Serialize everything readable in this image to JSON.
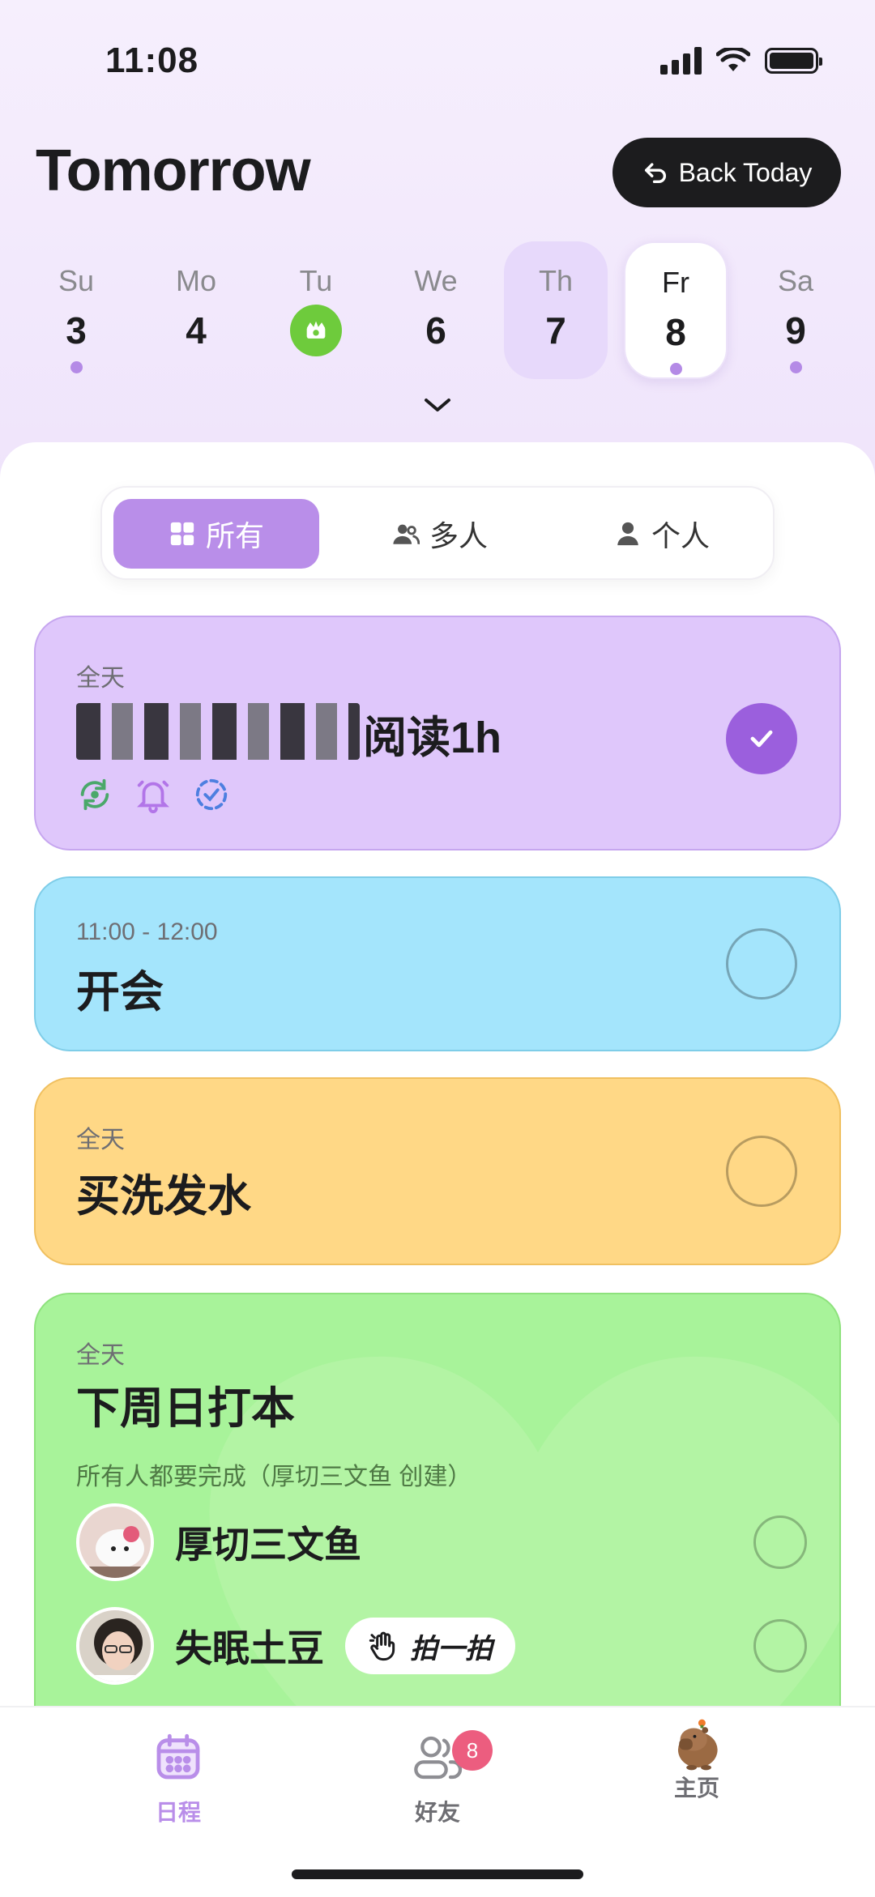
{
  "status_bar": {
    "time": "11:08"
  },
  "header": {
    "title": "Tomorrow",
    "back_today_label": "Back Today"
  },
  "week": [
    {
      "name": "Su",
      "num": "3",
      "has_dot": true
    },
    {
      "name": "Mo",
      "num": "4",
      "has_dot": false
    },
    {
      "name": "Tu",
      "num": "",
      "is_today_badge": true
    },
    {
      "name": "We",
      "num": "6",
      "has_dot": false
    },
    {
      "name": "Th",
      "num": "7",
      "has_dot": false,
      "highlight": true
    },
    {
      "name": "Fr",
      "num": "8",
      "has_dot": true,
      "selected": true
    },
    {
      "name": "Sa",
      "num": "9",
      "has_dot": true
    }
  ],
  "filters": [
    {
      "label": "所有",
      "icon": "grid-icon",
      "active": true
    },
    {
      "label": "多人",
      "icon": "people-icon",
      "active": false
    },
    {
      "label": "个人",
      "icon": "person-icon",
      "active": false
    }
  ],
  "tasks": [
    {
      "time": "全天",
      "title": "阅读1h",
      "done": true,
      "color": "#dfc7fb",
      "icons": [
        "repeat-icon",
        "bell-icon",
        "check-dashed-icon"
      ]
    },
    {
      "time": "11:00 - 12:00",
      "title": "开会",
      "done": false,
      "color": "#a4e5fc"
    },
    {
      "time": "全天",
      "title": "买洗发水",
      "done": false,
      "color": "#ffd886"
    },
    {
      "time": "全天",
      "title": "下周日打本",
      "note": "所有人都要完成（厚切三文鱼 创建）",
      "done": false,
      "color": "#a8f39a",
      "members": [
        {
          "name": "厚切三文鱼"
        },
        {
          "name": "失眠土豆",
          "action": "拍一拍"
        }
      ]
    }
  ],
  "tab_bar": {
    "tabs": [
      {
        "label": "日程",
        "icon": "calendar-icon",
        "active": true
      },
      {
        "label": "好友",
        "icon": "friends-icon",
        "badge": "8"
      },
      {
        "label": "主页",
        "icon": "capybara-avatar-icon"
      }
    ]
  },
  "colors": {
    "accent": "#b98ee9",
    "done": "#9b5fdd",
    "badge": "#ec5d7f",
    "today": "#6ecb3c"
  }
}
